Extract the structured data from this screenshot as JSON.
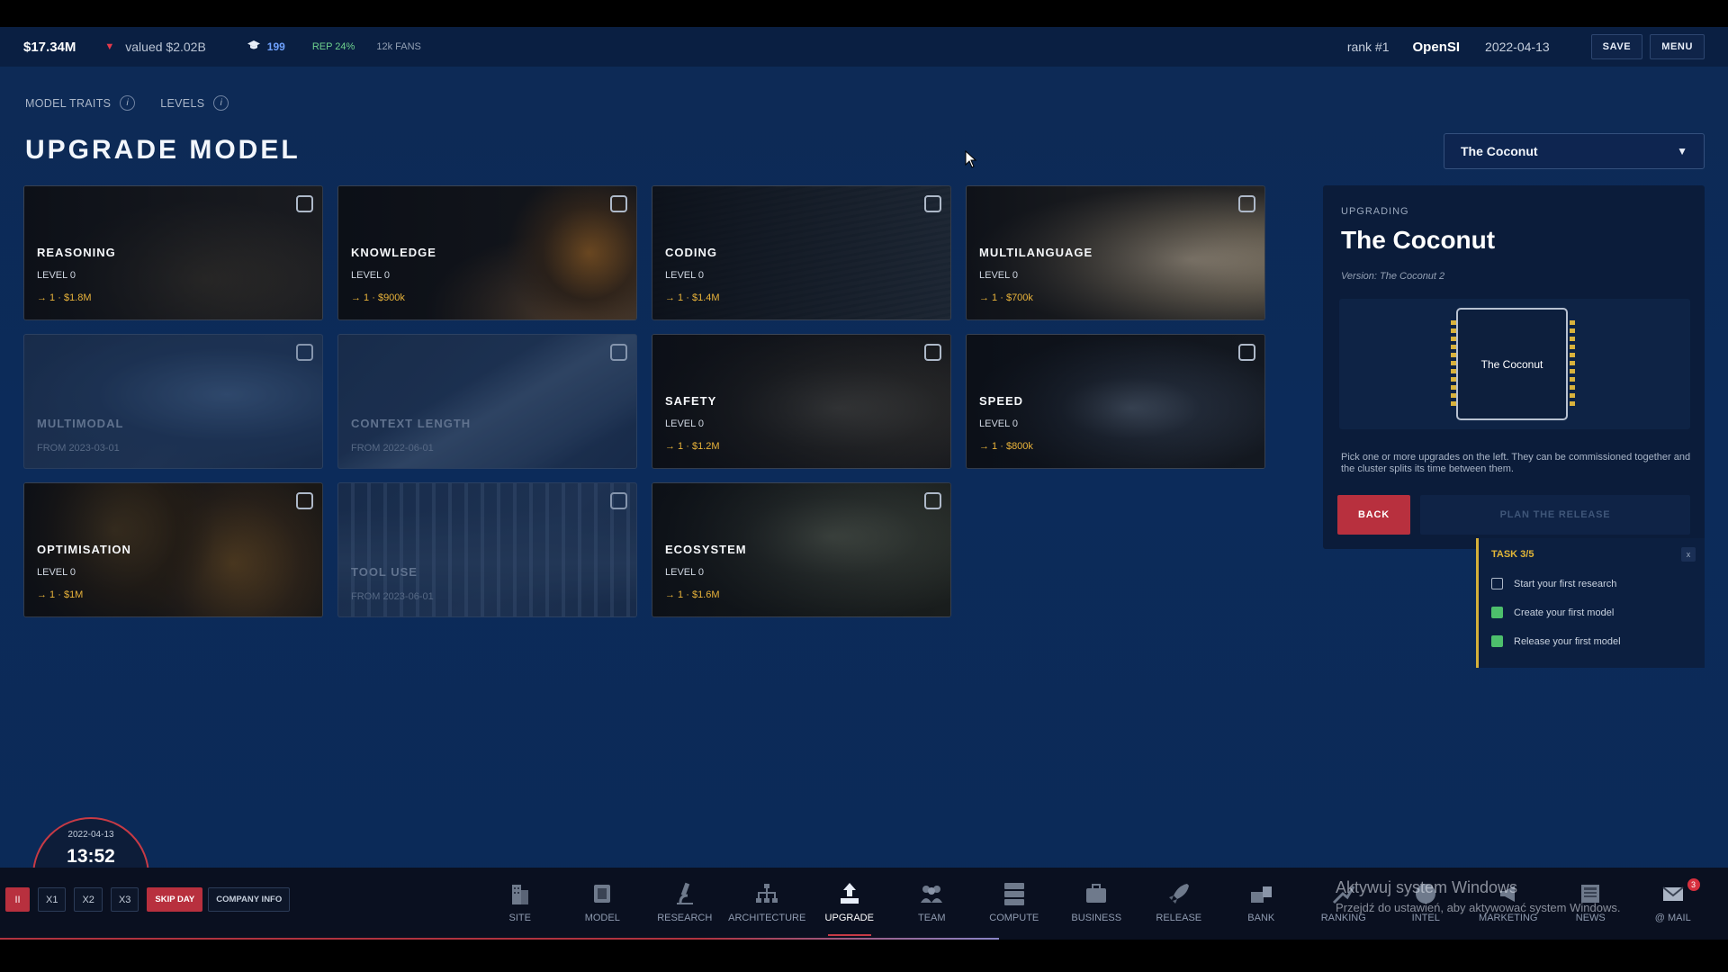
{
  "topbar": {
    "money": "$17.34M",
    "trend_arrow": "▼",
    "valued": "valued $2.02B",
    "research_icon": "graduation-cap-icon",
    "research_points": "199",
    "reputation": "REP 24%",
    "fans": "12k FANS",
    "rank": "rank #1",
    "company": "OpenSI",
    "date": "2022-04-13",
    "save_label": "SAVE",
    "menu_label": "MENU"
  },
  "subnav": {
    "traits_label": "MODEL TRAITS",
    "levels_label": "LEVELS",
    "info_glyph": "i"
  },
  "page_title": "UPGRADE MODEL",
  "model_select": {
    "value": "The Coconut",
    "caret": "▼"
  },
  "cards": [
    {
      "name": "REASONING",
      "level": "LEVEL 0",
      "cost": "→ 1 · $1.8M"
    },
    {
      "name": "KNOWLEDGE",
      "level": "LEVEL 0",
      "cost": "→ 1 · $900k"
    },
    {
      "name": "CODING",
      "level": "LEVEL 0",
      "cost": "→ 1 · $1.4M"
    },
    {
      "name": "MULTILANGUAGE",
      "level": "LEVEL 0",
      "cost": "→ 1 · $700k"
    },
    {
      "name": "MULTIMODAL",
      "from": "FROM 2023-03-01"
    },
    {
      "name": "CONTEXT LENGTH",
      "from": "FROM 2022-06-01"
    },
    {
      "name": "SAFETY",
      "level": "LEVEL 0",
      "cost": "→ 1 · $1.2M"
    },
    {
      "name": "SPEED",
      "level": "LEVEL 0",
      "cost": "→ 1 · $800k"
    },
    {
      "name": "OPTIMISATION",
      "level": "LEVEL 0",
      "cost": "→ 1 · $1M"
    },
    {
      "name": "TOOL USE",
      "from": "FROM 2023-06-01"
    },
    {
      "name": "ECOSYSTEM",
      "level": "LEVEL 0",
      "cost": "→ 1 · $1.6M"
    }
  ],
  "panel": {
    "label": "UPGRADING",
    "model_name": "The Coconut",
    "version": "Version: The Coconut 2",
    "chip_label": "The Coconut",
    "hint": "Pick one or more upgrades on the left. They can be commissioned together and the cluster splits its time between them.",
    "back_label": "BACK",
    "plan_label": "PLAN THE RELEASE"
  },
  "tasks": {
    "title": "TASK 3/5",
    "close": "x",
    "items": [
      {
        "label": "Start your first research",
        "done": false
      },
      {
        "label": "Create your first model",
        "done": true
      },
      {
        "label": "Release your first model",
        "done": true
      }
    ]
  },
  "clock": {
    "date": "2022-04-13",
    "time": "13:52"
  },
  "speed": {
    "pause": "II",
    "x1": "X1",
    "x2": "X2",
    "x3": "X3",
    "skip": "SKIP DAY",
    "company_info": "COMPANY INFO"
  },
  "nav": [
    {
      "label": "SITE",
      "icon": "building-icon"
    },
    {
      "label": "MODEL",
      "icon": "chip-icon"
    },
    {
      "label": "RESEARCH",
      "icon": "microscope-icon"
    },
    {
      "label": "ARCHITECTURE",
      "icon": "hierarchy-icon"
    },
    {
      "label": "UPGRADE",
      "icon": "upgrade-icon",
      "active": true
    },
    {
      "label": "TEAM",
      "icon": "team-icon"
    },
    {
      "label": "COMPUTE",
      "icon": "server-icon"
    },
    {
      "label": "BUSINESS",
      "icon": "briefcase-icon"
    },
    {
      "label": "RELEASE",
      "icon": "rocket-icon"
    },
    {
      "label": "BANK",
      "icon": "bank-icon"
    },
    {
      "label": "RANKING",
      "icon": "ranking-icon"
    },
    {
      "label": "INTEL",
      "icon": "globe-icon"
    },
    {
      "label": "MARKETING",
      "icon": "megaphone-icon"
    },
    {
      "label": "NEWS",
      "icon": "newspaper-icon"
    },
    {
      "label": "@ MAIL",
      "icon": "mail-icon",
      "badge": "3"
    }
  ],
  "watermark": {
    "line1": "Aktywuj system Windows",
    "line2": "Przejdź do ustawień, aby aktywować system Windows."
  },
  "colors": {
    "background": "#0c2b5a",
    "accent_red": "#b8303e",
    "cost_gold": "#e9b33a",
    "task_green": "#4dbf6c"
  }
}
